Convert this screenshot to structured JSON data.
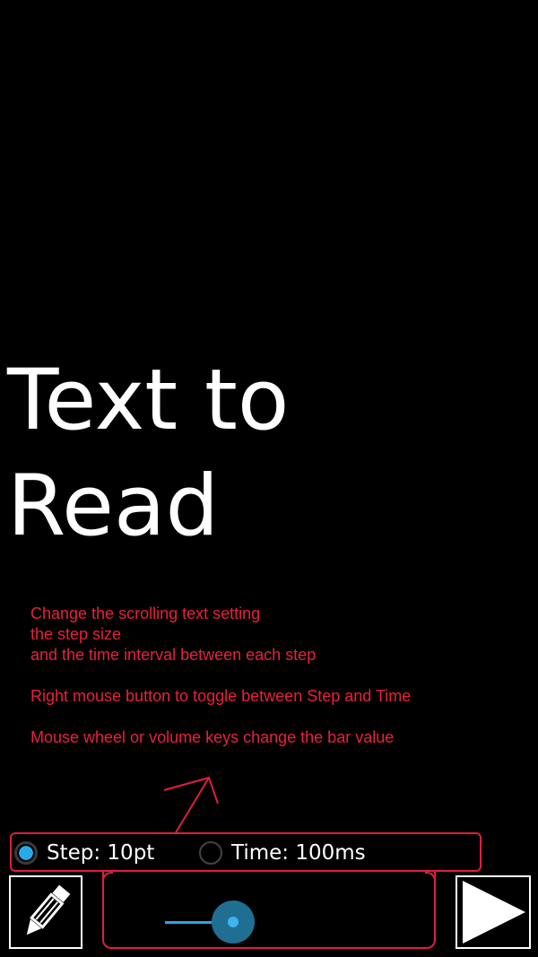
{
  "reading": {
    "line1": "Text to",
    "line2": "Read"
  },
  "help": {
    "line1": "Change the scrolling text setting",
    "line2": "the step size",
    "line3": "and the time interval between each step",
    "line4": "Right mouse button to toggle between Step and Time",
    "line5": "Mouse wheel or volume keys change the bar value"
  },
  "modes": {
    "step": {
      "label": "Step: 10pt",
      "checked": true
    },
    "time": {
      "label": "Time: 100ms",
      "checked": false
    }
  },
  "slider": {
    "value": 0.2
  },
  "icons": {
    "edit": "pencil-icon",
    "play": "play-icon"
  },
  "colors": {
    "background": "#000000",
    "annotation": "#e01e3c",
    "accent": "#2aa9e8"
  }
}
